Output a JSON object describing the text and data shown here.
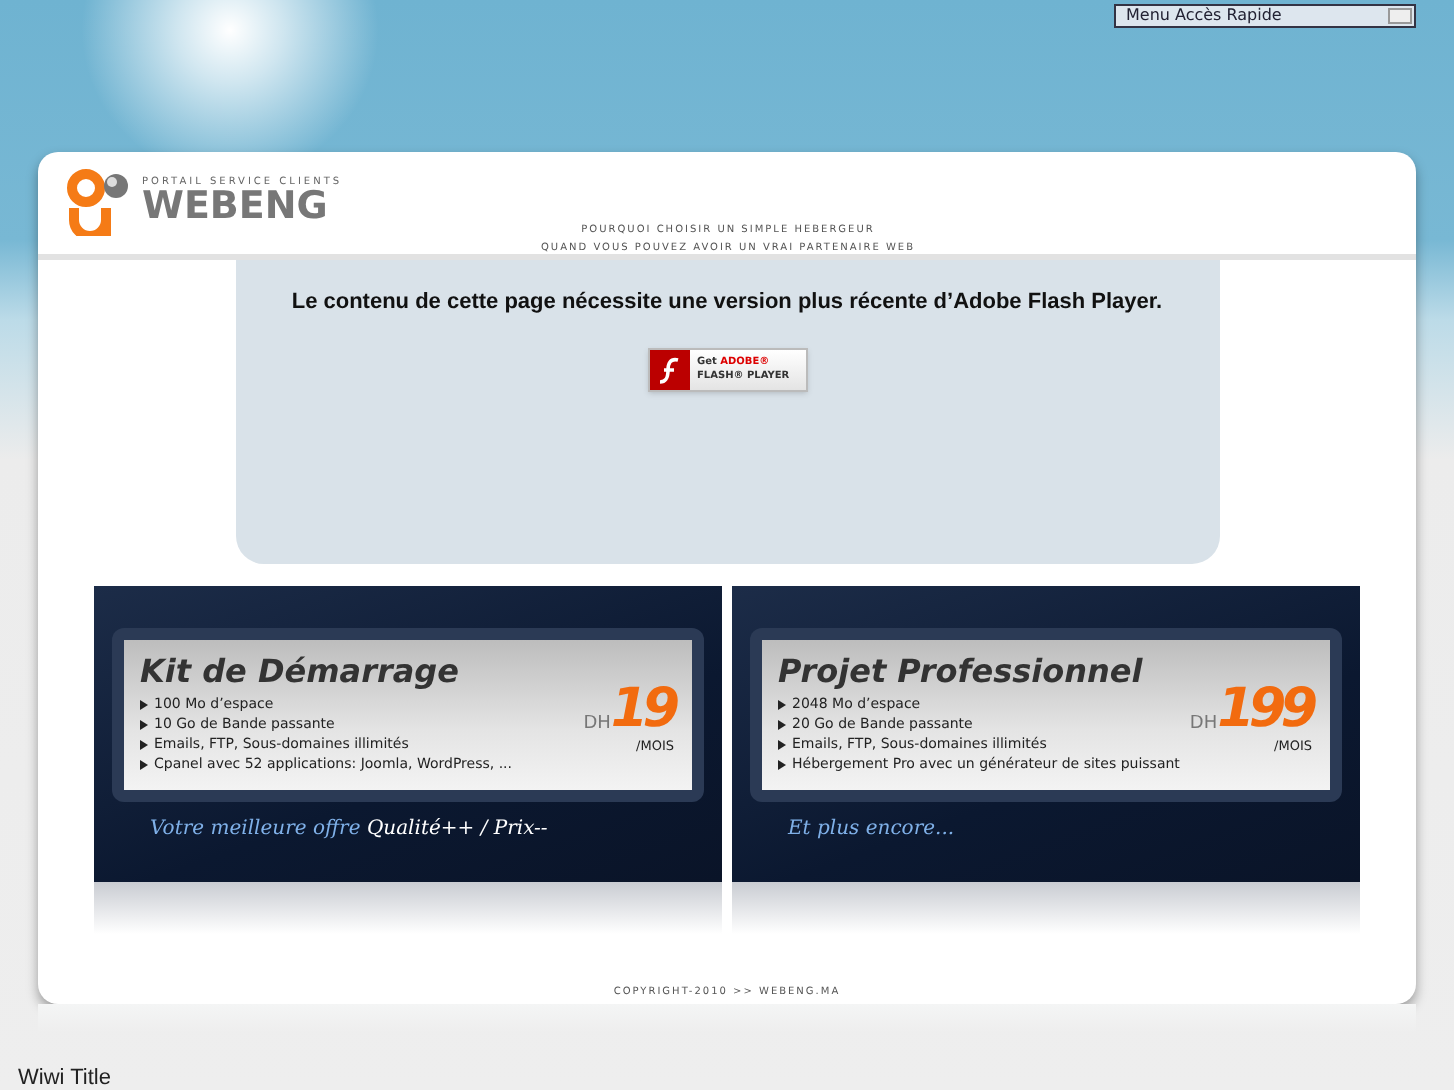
{
  "quick_menu": {
    "label": "Menu Accès Rapide"
  },
  "header": {
    "logo_tagline": "PORTAIL SERVICE CLIENTS",
    "logo_name": "WEBENG",
    "slogan_lines": [
      "POURQUOI CHOISIR UN SIMPLE HEBERGEUR",
      "QUAND VOUS POUVEZ AVOIR UN VRAI PARTENAIRE WEB"
    ]
  },
  "flash": {
    "message": "Le contenu de cette page nécessite une version plus récente d’Adobe Flash Player.",
    "badge_get": "Get",
    "badge_adobe": "ADOBE®",
    "badge_product": "FLASH® PLAYER"
  },
  "offers": [
    {
      "title": "Kit de Démarrage",
      "price": "19",
      "currency": "DH",
      "period": "/MOIS",
      "features": [
        "100 Mo d’espace",
        "10 Go de Bande passante",
        "Emails, FTP, Sous-domaines illimités",
        "Cpanel avec 52 applications: Joomla, WordPress, ..."
      ],
      "tagline": "Votre meilleure offre",
      "tagline_bold": "Qualité++ / Prix--"
    },
    {
      "title": "Projet Professionnel",
      "price": "199",
      "currency": "DH",
      "period": "/MOIS",
      "features": [
        "2048 Mo d’espace",
        "20 Go de Bande passante",
        "Emails, FTP, Sous-domaines illimités",
        "Hébergement Pro avec un générateur de sites puissant"
      ],
      "tagline": "Et plus encore..."
    }
  ],
  "footer": {
    "copyright": "COPYRIGHT-2010 >> WEBENG.MA"
  },
  "page_title": "Wiwi Title"
}
